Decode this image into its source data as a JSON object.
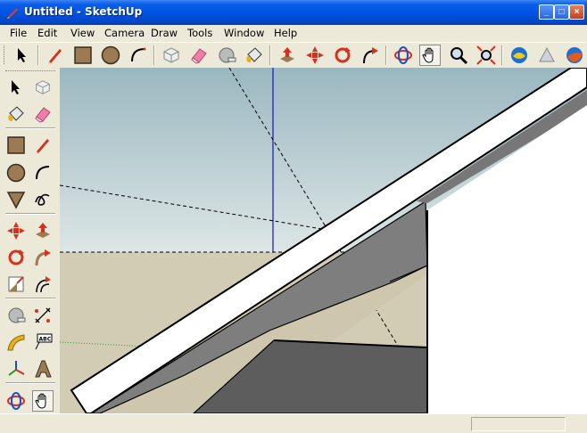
{
  "window": {
    "title": "Untitled - SketchUp",
    "minimize": "_",
    "maximize": "□",
    "close": "×"
  },
  "menu": {
    "items": [
      "File",
      "Edit",
      "View",
      "Camera",
      "Draw",
      "Tools",
      "Window",
      "Help"
    ]
  },
  "toolbar": {
    "items": [
      "select-arrow-icon",
      "line-pencil-icon",
      "rectangle-icon",
      "circle-icon",
      "arc-icon",
      "make-component-icon",
      "eraser-icon",
      "tape-measure-icon",
      "paint-bucket-icon",
      "push-pull-icon",
      "move-icon",
      "rotate-icon",
      "follow-me-icon",
      "orbit-icon",
      "pan-hand-icon",
      "zoom-icon",
      "zoom-extents-icon",
      "get-models-icon",
      "share-model-icon",
      "google-earth-icon"
    ]
  },
  "left_toolbar": {
    "items": [
      "select-arrow-icon",
      "make-component-icon",
      "paint-bucket-icon",
      "eraser-icon",
      "rectangle-icon",
      "line-pencil-icon",
      "circle-icon",
      "arc-icon",
      "polygon-icon",
      "freehand-icon",
      "move-icon",
      "push-pull-icon",
      "rotate-icon",
      "follow-me-icon",
      "scale-icon",
      "offset-icon",
      "tape-measure-icon",
      "dimension-icon",
      "protractor-icon",
      "text-label-icon",
      "axes-icon",
      "3d-text-icon",
      "orbit-icon",
      "pan-hand-icon"
    ]
  },
  "viewport": {
    "sky_top": "#9ab7c0",
    "sky_bottom": "#dde6e5",
    "ground": "#d3ccb5",
    "blue_axis": "#1414c8",
    "green_axis": "#2a9a2a"
  },
  "status": {
    "measurements": ""
  }
}
